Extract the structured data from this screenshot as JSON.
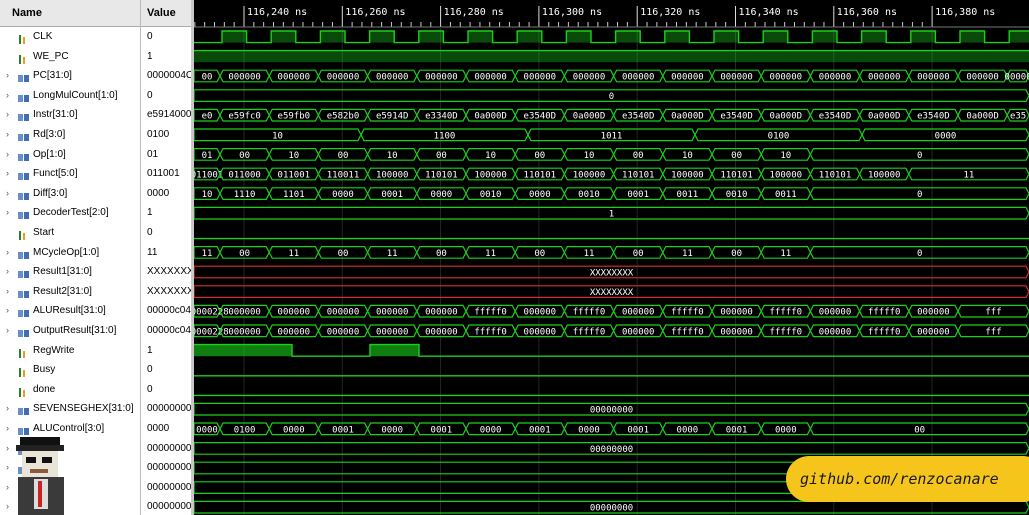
{
  "panels": {
    "name_header": "Name",
    "value_header": "Value"
  },
  "timeline": {
    "ticks": [
      "116,240 ns",
      "116,260 ns",
      "116,280 ns",
      "116,300 ns",
      "116,320 ns",
      "116,340 ns",
      "116,360 ns",
      "116,380 ns"
    ]
  },
  "signals": [
    {
      "name": "CLK",
      "value": "0",
      "kind": "bit",
      "expandable": false,
      "icon": "bit-icon"
    },
    {
      "name": "WE_PC",
      "value": "1",
      "kind": "bit",
      "expandable": false,
      "icon": "bit-icon"
    },
    {
      "name": "PC[31:0]",
      "value": "0000004C",
      "kind": "bus",
      "expandable": true,
      "icon": "bus-icon",
      "segs": [
        "00",
        "000000",
        "000000",
        "000000",
        "000000",
        "000000",
        "000000",
        "000000",
        "000000",
        "000000",
        "000000",
        "000000",
        "000000",
        "000000",
        "000000",
        "000000",
        "000000",
        "00000"
      ]
    },
    {
      "name": "LongMulCount[1:0]",
      "value": "0",
      "kind": "bus",
      "expandable": true,
      "icon": "bus-icon",
      "segs": [
        "0"
      ]
    },
    {
      "name": "Instr[31:0]",
      "value": "e5914000",
      "kind": "bus",
      "expandable": true,
      "icon": "bus-icon",
      "segs": [
        "e0",
        "e59fc0",
        "e59fb0",
        "e582b0",
        "e5914D",
        "e3340D",
        "0a000D",
        "e3540D",
        "0a000D",
        "e3540D",
        "0a000D",
        "e3540D",
        "0a000D",
        "e3540D",
        "0a000D",
        "e3540D",
        "0a000D",
        "e35"
      ]
    },
    {
      "name": "Rd[3:0]",
      "value": "0100",
      "kind": "bus",
      "expandable": true,
      "icon": "bus-icon",
      "segs": [
        "10",
        "1100",
        "1011",
        "0100",
        "0000"
      ]
    },
    {
      "name": "Op[1:0]",
      "value": "01",
      "kind": "bus",
      "expandable": true,
      "icon": "bus-icon",
      "segs": [
        "01",
        "00",
        "10",
        "00",
        "10",
        "00",
        "10",
        "00",
        "10",
        "00",
        "10",
        "00",
        "10",
        "0"
      ]
    },
    {
      "name": "Funct[5:0]",
      "value": "011001",
      "kind": "bus",
      "expandable": true,
      "icon": "bus-icon",
      "segs": [
        "011001",
        "011000",
        "011001",
        "110011",
        "100000",
        "110101",
        "100000",
        "110101",
        "100000",
        "110101",
        "100000",
        "110101",
        "100000",
        "110101",
        "100000",
        "11"
      ]
    },
    {
      "name": "Diff[3:0]",
      "value": "0000",
      "kind": "bus",
      "expandable": true,
      "icon": "bus-icon",
      "segs": [
        "10",
        "1110",
        "1101",
        "0000",
        "0001",
        "0000",
        "0010",
        "0000",
        "0010",
        "0001",
        "0011",
        "0010",
        "0011",
        "0"
      ]
    },
    {
      "name": "DecoderTest[2:0]",
      "value": "1",
      "kind": "bus",
      "expandable": true,
      "icon": "bus-icon",
      "segs": [
        "1"
      ]
    },
    {
      "name": "Start",
      "value": "0",
      "kind": "bit",
      "expandable": false,
      "icon": "bit-icon"
    },
    {
      "name": "MCycleOp[1:0]",
      "value": "11",
      "kind": "bus",
      "expandable": true,
      "icon": "bus-icon",
      "segs": [
        "11",
        "00",
        "11",
        "00",
        "11",
        "00",
        "11",
        "00",
        "11",
        "00",
        "11",
        "00",
        "11",
        "0"
      ]
    },
    {
      "name": "Result1[31:0]",
      "value": "XXXXXXXX",
      "kind": "busx",
      "expandable": true,
      "icon": "bus-icon",
      "segs": [
        "XXXXXXXX"
      ]
    },
    {
      "name": "Result2[31:0]",
      "value": "XXXXXXXX",
      "kind": "busx",
      "expandable": true,
      "icon": "bus-icon",
      "segs": [
        "XXXXXXXX"
      ]
    },
    {
      "name": "ALUResult[31:0]",
      "value": "00000c04",
      "kind": "bus",
      "expandable": true,
      "icon": "bus-icon",
      "segs": [
        "00000228",
        "000000",
        "000000",
        "000000",
        "000000",
        "000000",
        "fffff0",
        "000000",
        "fffff0",
        "000000",
        "fffff0",
        "000000",
        "fffff0",
        "000000",
        "fffff0",
        "000000",
        "fff"
      ]
    },
    {
      "name": "OutputResult[31:0]",
      "value": "00000c04",
      "kind": "bus",
      "expandable": true,
      "icon": "bus-icon",
      "segs": [
        "00000228",
        "000000",
        "000000",
        "000000",
        "000000",
        "000000",
        "fffff0",
        "000000",
        "fffff0",
        "000000",
        "fffff0",
        "000000",
        "fffff0",
        "000000",
        "fffff0",
        "000000",
        "fff"
      ]
    },
    {
      "name": "RegWrite",
      "value": "1",
      "kind": "bit",
      "expandable": false,
      "icon": "bit-icon"
    },
    {
      "name": "Busy",
      "value": "0",
      "kind": "bit",
      "expandable": false,
      "icon": "bit-icon"
    },
    {
      "name": "done",
      "value": "0",
      "kind": "bit",
      "expandable": false,
      "icon": "bit-icon"
    },
    {
      "name": "SEVENSEGHEX[31:0]",
      "value": "00000000",
      "kind": "bus",
      "expandable": true,
      "icon": "bus-icon",
      "segs": [
        "00000000"
      ]
    },
    {
      "name": "ALUControl[3:0]",
      "value": "0000",
      "kind": "bus",
      "expandable": true,
      "icon": "bus-icon",
      "segs": [
        "0000",
        "0100",
        "0000",
        "0001",
        "0000",
        "0001",
        "0000",
        "0001",
        "0000",
        "0001",
        "0000",
        "0001",
        "0000",
        "00"
      ]
    },
    {
      "name": ":0]",
      "value": "00000000",
      "kind": "bus",
      "expandable": true,
      "icon": "bus-icon",
      "segs": [
        "00000000"
      ]
    },
    {
      "name": "0]",
      "value": "00000000",
      "kind": "bus",
      "expandable": true,
      "icon": "bus-icon",
      "segs": [
        ""
      ]
    },
    {
      "name": "0]",
      "value": "00000000",
      "kind": "bus",
      "expandable": true,
      "icon": "bus-icon",
      "segs": [
        ""
      ]
    },
    {
      "name": "1:0]",
      "value": "00000000",
      "kind": "bus",
      "expandable": true,
      "icon": "bus-icon",
      "segs": [
        "00000000"
      ]
    }
  ],
  "badge": {
    "text": "github.com/renzocanare"
  },
  "colors": {
    "wave": "#19d119",
    "xwave": "#d23030",
    "bus_text": "#ffffff",
    "grid": "#2a2a2a"
  }
}
